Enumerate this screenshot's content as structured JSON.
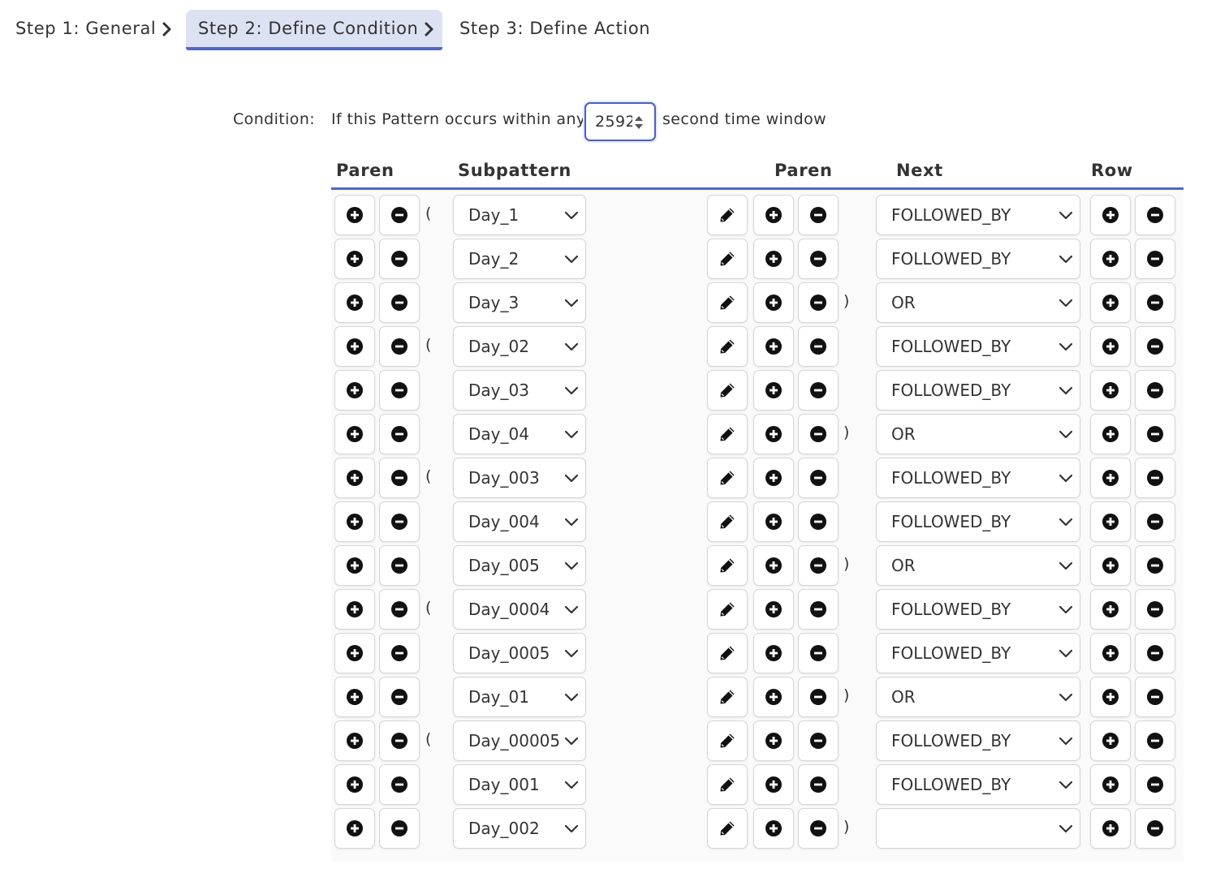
{
  "steps": [
    {
      "label": "Step 1: General",
      "active": false
    },
    {
      "label": "Step 2: Define Condition",
      "active": true
    },
    {
      "label": "Step 3: Define Action",
      "active": false
    }
  ],
  "condition": {
    "label": "Condition:",
    "prefix": "If this Pattern occurs within any",
    "window_value": "2592",
    "suffix": "second time window"
  },
  "table": {
    "headers": {
      "paren_left": "Paren",
      "subpattern": "Subpattern",
      "paren_right": "Paren",
      "next": "Next",
      "row": "Row"
    },
    "rows": [
      {
        "open": "(",
        "subpattern": "Day_1",
        "close": "",
        "next": "FOLLOWED_BY"
      },
      {
        "open": "",
        "subpattern": "Day_2",
        "close": "",
        "next": "FOLLOWED_BY"
      },
      {
        "open": "",
        "subpattern": "Day_3",
        "close": ")",
        "next": "OR"
      },
      {
        "open": "(",
        "subpattern": "Day_02",
        "close": "",
        "next": "FOLLOWED_BY"
      },
      {
        "open": "",
        "subpattern": "Day_03",
        "close": "",
        "next": "FOLLOWED_BY"
      },
      {
        "open": "",
        "subpattern": "Day_04",
        "close": ")",
        "next": "OR"
      },
      {
        "open": "(",
        "subpattern": "Day_003",
        "close": "",
        "next": "FOLLOWED_BY"
      },
      {
        "open": "",
        "subpattern": "Day_004",
        "close": "",
        "next": "FOLLOWED_BY"
      },
      {
        "open": "",
        "subpattern": "Day_005",
        "close": ")",
        "next": "OR"
      },
      {
        "open": "(",
        "subpattern": "Day_0004",
        "close": "",
        "next": "FOLLOWED_BY"
      },
      {
        "open": "",
        "subpattern": "Day_0005",
        "close": "",
        "next": "FOLLOWED_BY"
      },
      {
        "open": "",
        "subpattern": "Day_01",
        "close": ")",
        "next": "OR"
      },
      {
        "open": "(",
        "subpattern": "Day_00005",
        "close": "",
        "next": "FOLLOWED_BY"
      },
      {
        "open": "",
        "subpattern": "Day_001",
        "close": "",
        "next": "FOLLOWED_BY"
      },
      {
        "open": "",
        "subpattern": "Day_002",
        "close": ")",
        "next": ""
      }
    ]
  },
  "icons": {
    "add": "plus-circle-icon",
    "remove": "minus-circle-icon",
    "edit": "pencil-icon",
    "dropdown": "chevron-down-icon",
    "step_separator": "chevron-right-icon"
  },
  "colors": {
    "accent": "#5566c0",
    "active_tab_bg": "#dde2f3",
    "text": "#333333"
  }
}
